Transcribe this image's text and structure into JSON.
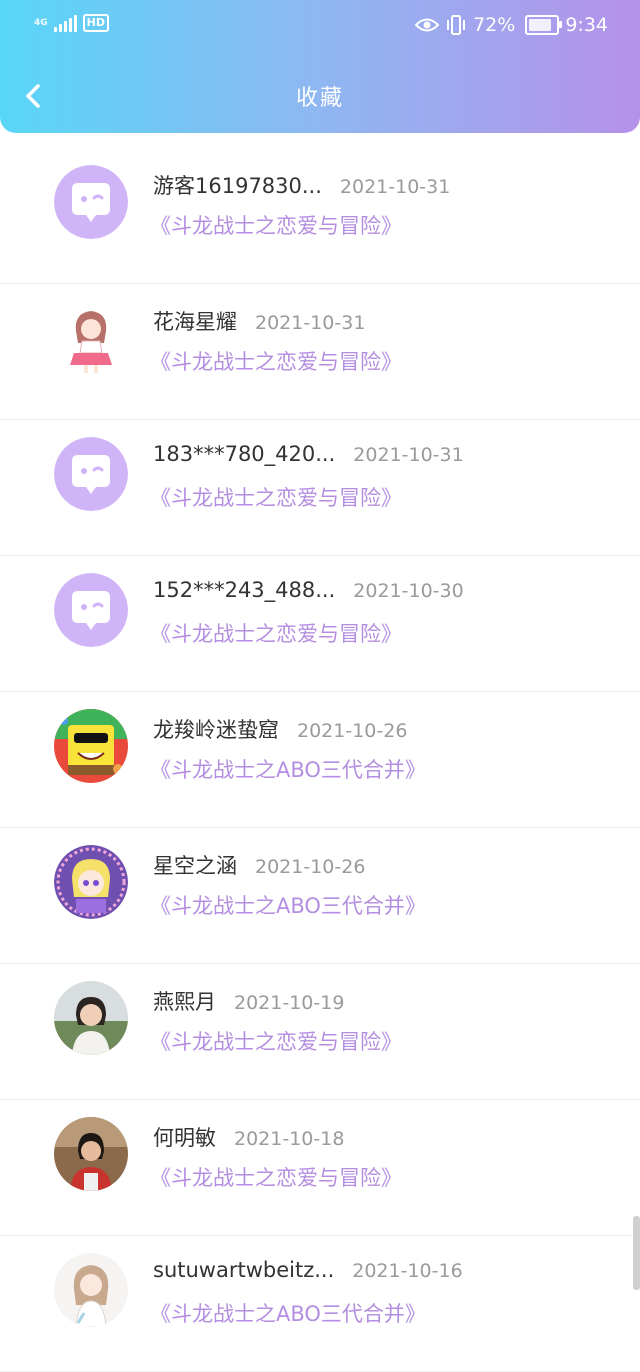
{
  "status_bar": {
    "network_type": "4G",
    "hd_label": "HD",
    "battery_percent": "72%",
    "battery_level": 0.72,
    "time": "9:34"
  },
  "header": {
    "title": "收藏",
    "back_icon": "chevron-left-icon"
  },
  "colors": {
    "header_gradient": [
      "#58d6f7",
      "#8fb7f1",
      "#b592ea"
    ],
    "book_title": "#b48ee0",
    "default_avatar": "#cfb5f8"
  },
  "favorites": [
    {
      "user": "游客16197830...",
      "date": "2021-10-31",
      "book": "《斗龙战士之恋爱与冒险》",
      "avatar": "default-chat-avatar"
    },
    {
      "user": "花海星耀",
      "date": "2021-10-31",
      "book": "《斗龙战士之恋爱与冒险》",
      "avatar": "anime-girl-avatar"
    },
    {
      "user": "183***780_420...",
      "date": "2021-10-31",
      "book": "《斗龙战士之恋爱与冒险》",
      "avatar": "default-chat-avatar"
    },
    {
      "user": "152***243_488...",
      "date": "2021-10-30",
      "book": "《斗龙战士之恋爱与冒险》",
      "avatar": "default-chat-avatar"
    },
    {
      "user": "龙羧岭迷蛰窟",
      "date": "2021-10-26",
      "book": "《斗龙战士之ABO三代合并》",
      "avatar": "cartoon-sponge-avatar"
    },
    {
      "user": "星空之涵",
      "date": "2021-10-26",
      "book": "《斗龙战士之ABO三代合并》",
      "avatar": "anime-portrait-avatar"
    },
    {
      "user": "燕熙月",
      "date": "2021-10-19",
      "book": "《斗龙战士之恋爱与冒险》",
      "avatar": "photo-avatar"
    },
    {
      "user": "何明敏",
      "date": "2021-10-18",
      "book": "《斗龙战士之恋爱与冒险》",
      "avatar": "photo-avatar"
    },
    {
      "user": "sutuwartwbeitz...",
      "date": "2021-10-16",
      "book": "《斗龙战士之ABO三代合并》",
      "avatar": "anime-girl-avatar"
    }
  ]
}
